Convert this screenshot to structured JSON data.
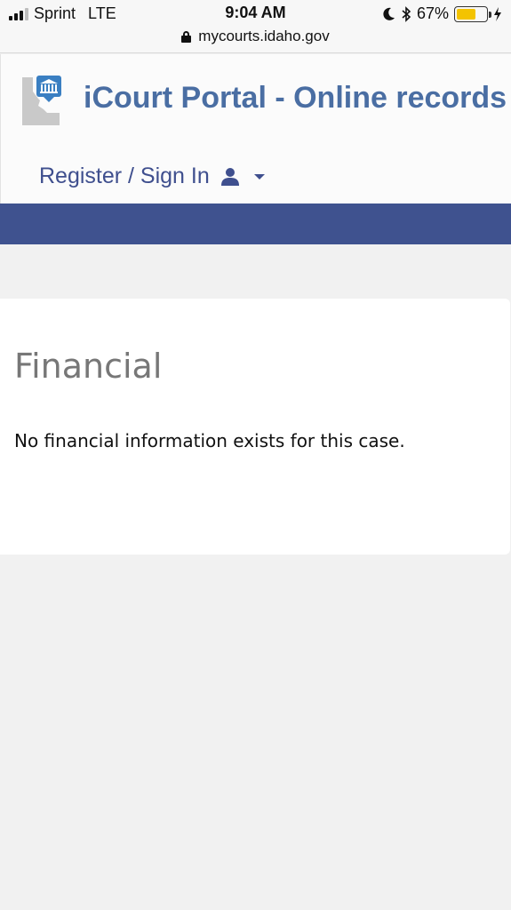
{
  "status_bar": {
    "carrier": "Sprint",
    "network": "LTE",
    "time": "9:04 AM",
    "battery_percent": "67%",
    "battery_level": 0.67,
    "url": "mycourts.idaho.gov",
    "icons": [
      "signal-icon",
      "moon-icon",
      "bluetooth-icon",
      "battery-icon",
      "charging-icon",
      "lock-icon"
    ]
  },
  "header": {
    "title": "iCourt Portal - Online records",
    "nav": {
      "signin_label": "Register / Sign In"
    },
    "icons": [
      "idaho-courthouse-logo",
      "user-icon",
      "caret-down-icon"
    ]
  },
  "colors": {
    "brand_title": "#4a6ea3",
    "nav_band": "#3f528f",
    "link": "#3f4f8e",
    "battery": "#f3c300"
  },
  "main": {
    "section_title": "Financial",
    "message": "No financial information exists for this case."
  }
}
